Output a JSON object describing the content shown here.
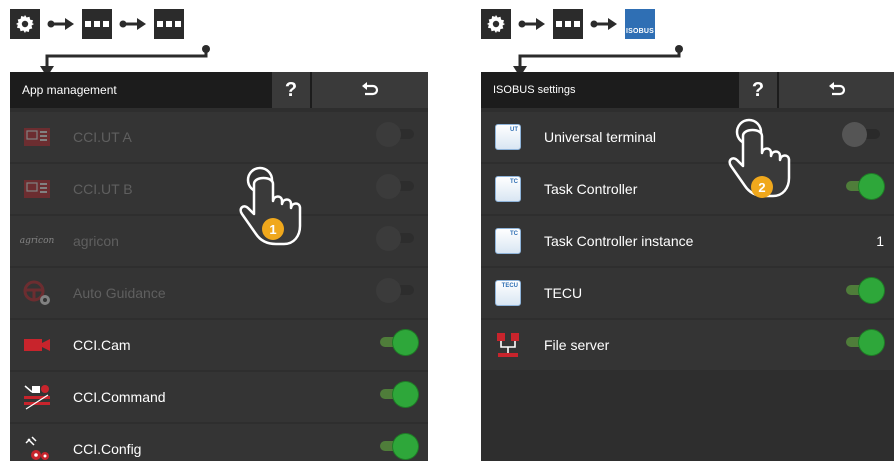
{
  "left": {
    "title": "App management",
    "help_label": "?",
    "back_icon": "return-arrow-icon",
    "apps": [
      {
        "label": "CCI.UT A",
        "icon": "ut-monitor-icon",
        "enabled": false,
        "state": "off"
      },
      {
        "label": "CCI.UT B",
        "icon": "ut-monitor-icon",
        "enabled": false,
        "state": "off"
      },
      {
        "label": "agricon",
        "icon": "agricon-logo-icon",
        "icon_text": "agricon",
        "enabled": false,
        "state": "off"
      },
      {
        "label": "Auto Guidance",
        "icon": "steering-wheel-gear-icon",
        "enabled": false,
        "state": "off"
      },
      {
        "label": "CCI.Cam",
        "icon": "camera-icon",
        "enabled": true,
        "state": "on"
      },
      {
        "label": "CCI.Command",
        "icon": "command-tractor-icon",
        "enabled": true,
        "state": "on"
      },
      {
        "label": "CCI.Config",
        "icon": "config-satellite-icon",
        "enabled": true,
        "state": "on"
      }
    ],
    "step_badge": "1"
  },
  "right": {
    "title": "ISOBUS settings",
    "help_label": "?",
    "back_icon": "return-arrow-icon",
    "items": [
      {
        "label": "Universal terminal",
        "icon": "ut-tile-icon",
        "tag": "UT",
        "control": "toggle",
        "state": "off"
      },
      {
        "label": "Task Controller",
        "icon": "tc-tile-icon",
        "tag": "TC",
        "control": "toggle",
        "state": "on"
      },
      {
        "label": "Task Controller instance",
        "icon": "tc-tile-icon",
        "tag": "TC",
        "control": "value",
        "value": "1"
      },
      {
        "label": "TECU",
        "icon": "tecu-tile-icon",
        "tag": "TECU",
        "control": "toggle",
        "state": "on"
      },
      {
        "label": "File server",
        "icon": "file-server-icon",
        "control": "toggle",
        "state": "on"
      }
    ],
    "step_badge": "2"
  },
  "breadcrumb_isobus_label": "ISOBUS",
  "colors": {
    "toggle_on": "#2ea73a",
    "badge": "#f0a81c",
    "isobus_blue": "#2f6fb4",
    "app_red": "#c8242c"
  }
}
